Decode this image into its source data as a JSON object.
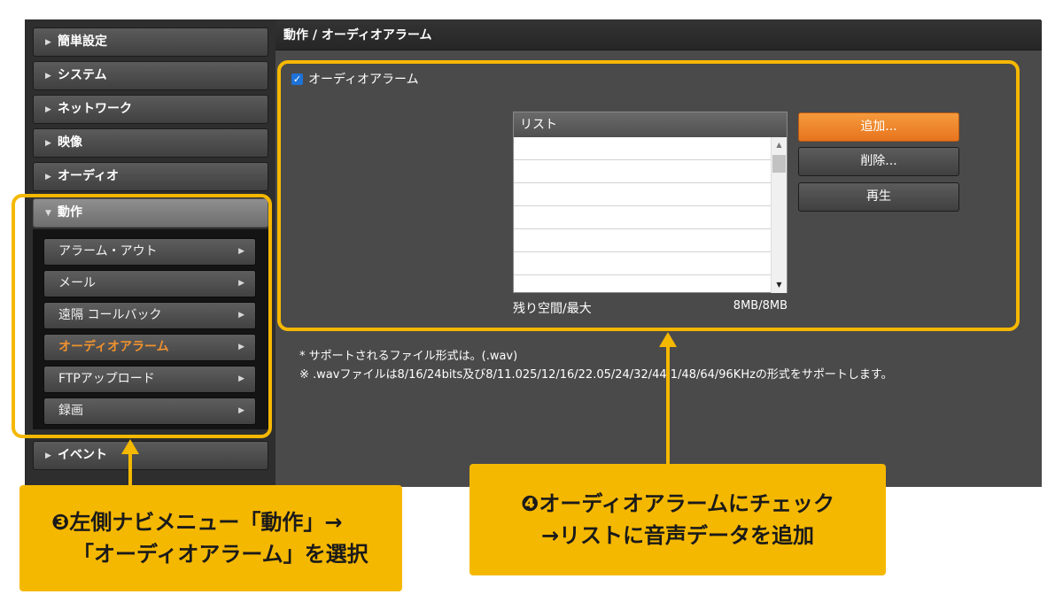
{
  "sidebar": {
    "items": [
      {
        "label": "簡単設定"
      },
      {
        "label": "システム"
      },
      {
        "label": "ネットワーク"
      },
      {
        "label": "映像"
      },
      {
        "label": "オーディオ"
      },
      {
        "label": "動作"
      },
      {
        "label": "イベント"
      }
    ],
    "submenu": [
      {
        "label": "アラーム・アウト"
      },
      {
        "label": "メール"
      },
      {
        "label": "遠隔 コールバック"
      },
      {
        "label": "オーディオアラーム",
        "active": true
      },
      {
        "label": "FTPアップロード"
      },
      {
        "label": "録画"
      }
    ]
  },
  "main": {
    "breadcrumb": "動作 / オーディオアラーム",
    "enable_checkbox": {
      "label": "オーディオアラーム",
      "checked": true
    },
    "list": {
      "header": "リスト",
      "rows": [
        "",
        "",
        "",
        "",
        "",
        ""
      ]
    },
    "space": {
      "label": "残り空間/最大",
      "value": "8MB/8MB"
    },
    "buttons": {
      "add": "追加...",
      "delete": "削除...",
      "play": "再生"
    },
    "notes": [
      "* サポートされるファイル形式は。(.wav)",
      "※ .wavファイルは8/16/24bits及び8/11.025/12/16/22.05/24/32/44.1/48/64/96KHzの形式をサポートします。"
    ]
  },
  "annotations": {
    "step3": {
      "line1": "❸左側ナビメニュー「動作」→",
      "line2": "「オーディオアラーム」を選択"
    },
    "step4": {
      "line1": "❹オーディオアラームにチェック",
      "line2": "→リストに音声データを追加"
    }
  },
  "colors": {
    "accent_orange": "#f0922e",
    "highlight_yellow": "#f5b800",
    "checkbox_blue": "#1e73d8"
  },
  "icons": {
    "collapsed": "triangle-right-icon",
    "expanded": "triangle-down-icon",
    "submenu_arrow": "chevron-right-icon",
    "checkbox": "check-icon"
  }
}
